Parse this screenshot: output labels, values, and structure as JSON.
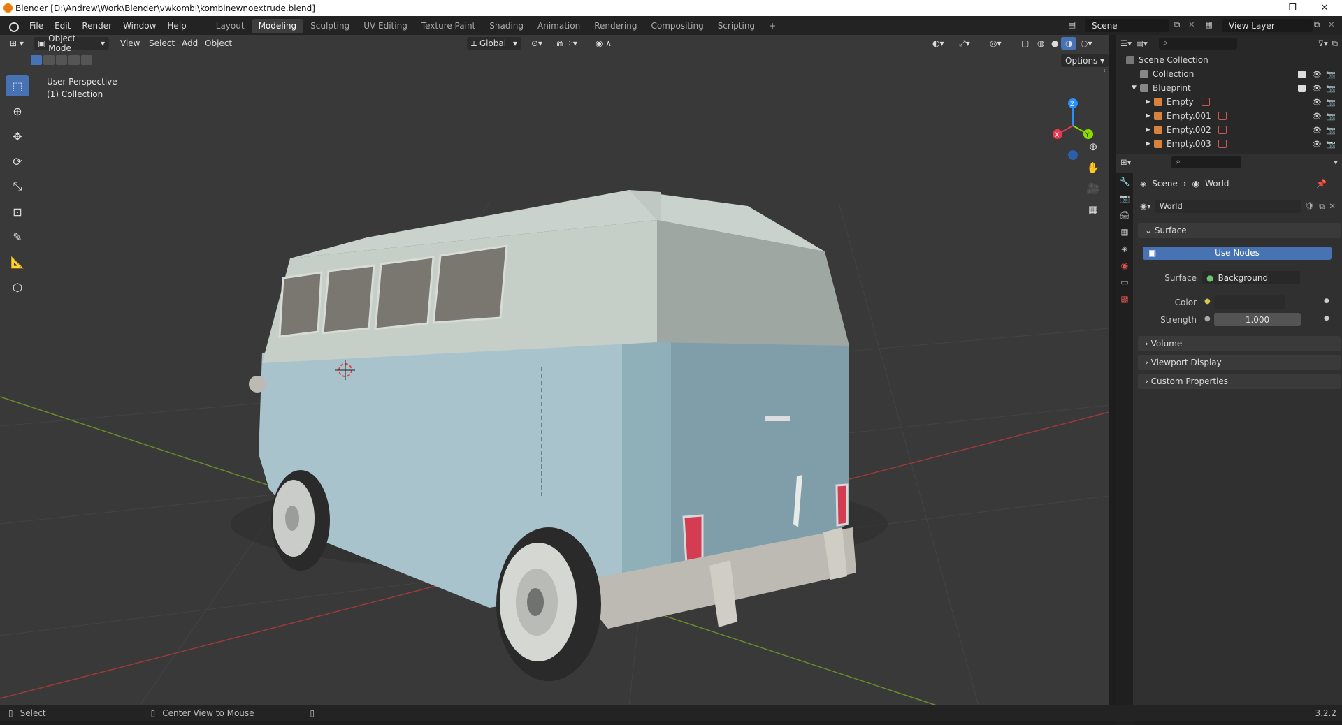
{
  "window": {
    "title": "Blender [D:\\Andrew\\Work\\Blender\\vwkombi\\kombinewnoextrude.blend]",
    "controls": [
      "—",
      "❐",
      "✕"
    ]
  },
  "menubar": {
    "items": [
      "File",
      "Edit",
      "Render",
      "Window",
      "Help"
    ],
    "workspaces": [
      "Layout",
      "Modeling",
      "Sculpting",
      "UV Editing",
      "Texture Paint",
      "Shading",
      "Animation",
      "Rendering",
      "Compositing",
      "Scripting"
    ],
    "active_workspace": "Modeling",
    "add_workspace": "+",
    "scene": "Scene",
    "view_layer": "View Layer"
  },
  "viewport": {
    "mode": "Object Mode",
    "menu": [
      "View",
      "Select",
      "Add",
      "Object"
    ],
    "transform_orientation": "Global",
    "options_label": "Options",
    "overlay_line1": "User Perspective",
    "overlay_line2": "(1) Collection",
    "gizmo_axes": [
      "Z",
      "Y",
      "X"
    ]
  },
  "outliner": {
    "root": "Scene Collection",
    "rows": [
      {
        "label": "Collection",
        "indent": 1
      },
      {
        "label": "Blueprint",
        "indent": 1
      },
      {
        "label": "Empty",
        "indent": 2
      },
      {
        "label": "Empty.001",
        "indent": 2
      },
      {
        "label": "Empty.002",
        "indent": 2
      },
      {
        "label": "Empty.003",
        "indent": 2
      }
    ]
  },
  "properties": {
    "breadcrumb": [
      "Scene",
      "World"
    ],
    "world_name": "World",
    "surface_panel": "Surface",
    "use_nodes": "Use Nodes",
    "surface_label": "Surface",
    "surface_value": "Background",
    "color_label": "Color",
    "strength_label": "Strength",
    "strength_value": "1.000",
    "collapsed_panels": [
      "Volume",
      "Viewport Display",
      "Custom Properties"
    ]
  },
  "statusbar": {
    "left": "Select",
    "middle": "Center View to Mouse",
    "version": "3.2.2"
  },
  "colors": {
    "accent": "#4772b3",
    "axis_x": "#e8384f",
    "axis_y": "#8bdc00",
    "axis_z": "#2890ff",
    "van_body": "#9fb8c3",
    "van_roof": "#c3ccc6"
  }
}
